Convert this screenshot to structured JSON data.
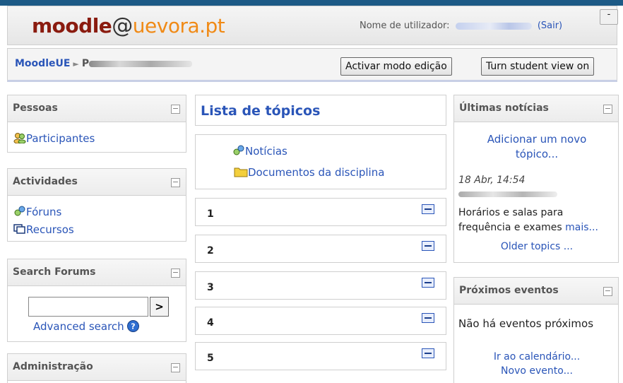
{
  "header": {
    "logo_moodle": "moodle",
    "logo_at": "@",
    "logo_domain": "uevora.pt",
    "user_label": "Nome de utilizador:",
    "logout_label": "(Sair)",
    "minimize_label": "-"
  },
  "navbar": {
    "home_link": "MoodleUE",
    "course_initial": "P",
    "edit_mode_button": "Activar modo edição",
    "student_view_button": "Turn student view on"
  },
  "left_blocks": {
    "people": {
      "title": "Pessoas",
      "items": [
        "Participantes"
      ]
    },
    "activities": {
      "title": "Actividades",
      "items": [
        "Fóruns",
        "Recursos"
      ]
    },
    "search": {
      "title": "Search Forums",
      "go_label": ">",
      "advanced_label": "Advanced search"
    },
    "admin": {
      "title": "Administração"
    }
  },
  "center": {
    "title": "Lista de tópicos",
    "topic0_items": [
      "Notícias",
      "Documentos da disciplina"
    ],
    "sections": [
      "1",
      "2",
      "3",
      "4",
      "5"
    ]
  },
  "right_blocks": {
    "news": {
      "title": "Últimas notícias",
      "add_topic": "Adicionar um novo tópico...",
      "date": "18 Abr, 14:54",
      "headline": "Horários e salas para frequência e exames",
      "more": "mais...",
      "older": "Older topics ..."
    },
    "events": {
      "title": "Próximos eventos",
      "none": "Não há eventos próximos",
      "calendar": "Ir ao calendário...",
      "new_event": "Novo evento..."
    }
  },
  "colors": {
    "accent": "#2a55b8",
    "brand": "#8a1b0f",
    "brand_secondary": "#f08a16",
    "top_strip": "#1d5a86"
  }
}
